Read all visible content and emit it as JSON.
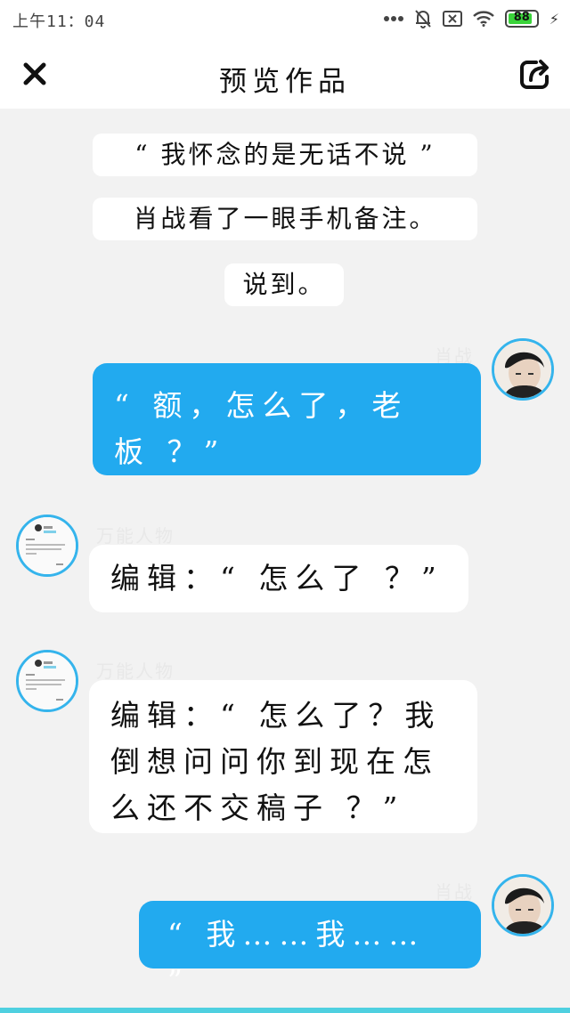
{
  "status_bar": {
    "time": "上午11：04",
    "battery": "88",
    "battery_level": 0.88
  },
  "header": {
    "title": "预览作品",
    "close_icon": "close-icon",
    "share_icon": "share-icon"
  },
  "narration": [
    "“ 我怀念的是无话不说 ”",
    "肖战看了一眼手机备注。",
    "说到。"
  ],
  "messages": [
    {
      "speaker": "肖战",
      "side": "right",
      "line1": "“ 额，怎么了，老",
      "line2": "板 ？”",
      "color": "#22aaef"
    },
    {
      "speaker": "万能人物",
      "side": "left",
      "line1": "编辑：“ 怎么了 ？”"
    },
    {
      "speaker": "万能人物",
      "side": "left",
      "line1": "编辑：“ 怎么了？我",
      "line2": "倒想问问你到现在怎",
      "line3": "么还不交稿子 ？”"
    },
    {
      "speaker": "肖战",
      "side": "right",
      "line1": "“ 我……我…… ”",
      "color": "#22aaef"
    }
  ],
  "colors": {
    "accent": "#22aaef",
    "avatar_border": "#35b4ec",
    "background": "#f2f2f2"
  }
}
